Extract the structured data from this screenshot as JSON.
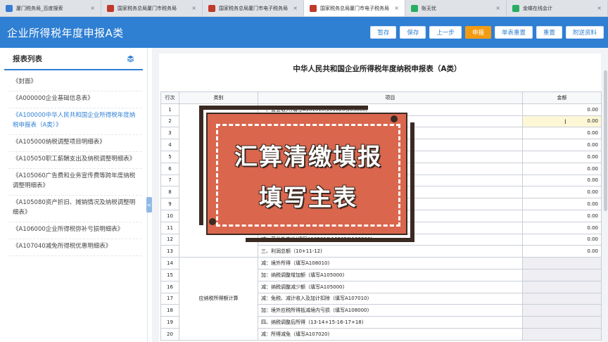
{
  "browser": {
    "tabs": [
      {
        "label": "厦门税务局_百度搜索",
        "color": "#3a7bd5",
        "active": false
      },
      {
        "label": "国家税务总局厦门市税务局",
        "color": "#c0392b",
        "active": false
      },
      {
        "label": "国家税务总局厦门市电子税务局",
        "color": "#c0392b",
        "active": false
      },
      {
        "label": "国家税务总局厦门市电子税务局",
        "color": "#c0392b",
        "active": true
      },
      {
        "label": "账无忧",
        "color": "#27ae60",
        "active": false
      },
      {
        "label": "金蝶在线会计",
        "color": "#27ae60",
        "active": false
      }
    ]
  },
  "header": {
    "title": "企业所得税年度申报A类",
    "buttons": [
      "暂存",
      "保存",
      "上一步",
      "申报",
      "单表重置",
      "重置",
      "附送资料"
    ]
  },
  "sidebar": {
    "title": "报表列表",
    "items": [
      "《封面》",
      "《A000000企业基础信息表》",
      "《A100000中华人民共和国企业所得税年度纳税申报表（A类）》",
      "《A105000纳税调整项目明细表》",
      "《A105050职工薪酬支出及纳税调整明细表》",
      "《A105060广告费和业务宣传费等跨年度纳税调整明细表》",
      "《A105080资产折旧、摊销情况及纳税调整明细表》",
      "《A106000企业所得税弥补亏损明细表》",
      "《A107040减免所得税优惠明细表》"
    ],
    "collapse": "<"
  },
  "form": {
    "title": "中华人民共和国企业所得税年度纳税申报表（A类）",
    "headers": [
      "行次",
      "类别",
      "项目",
      "金额"
    ],
    "rows": [
      {
        "no": "1",
        "item": "一、营业收入(填写A101010\\101020\\103000)",
        "amount": "0.00"
      },
      {
        "no": "2",
        "item": "",
        "amount": "0.00"
      },
      {
        "no": "3",
        "item": "",
        "amount": "0.00"
      },
      {
        "no": "4",
        "item": "",
        "amount": "0.00"
      },
      {
        "no": "5",
        "item": "",
        "amount": "0.00"
      },
      {
        "no": "6",
        "item": "",
        "amount": "0.00"
      },
      {
        "no": "7",
        "item": "",
        "amount": "0.00"
      },
      {
        "no": "8",
        "item": "",
        "amount": "0.00"
      },
      {
        "no": "9",
        "item": "",
        "amount": "0.00"
      },
      {
        "no": "10",
        "item": "",
        "amount": "0.00"
      },
      {
        "no": "11",
        "item": "",
        "amount": "0.00"
      },
      {
        "no": "12",
        "item": "减：营业外支出(填写A102010\\102020\\103000)",
        "amount": "0.00"
      },
      {
        "no": "13",
        "item": "三、利润总额（10+11-12)",
        "amount": "0.00"
      },
      {
        "no": "14",
        "item": "减：境外所得（填写A108010)",
        "amount": ""
      },
      {
        "no": "15",
        "item": "加：纳税调整增加额（填写A105000)",
        "amount": ""
      },
      {
        "no": "16",
        "item": "减：纳税调整减少额（填写A105000)",
        "amount": ""
      },
      {
        "no": "17",
        "item": "减：免税、减计收入及加计扣除（填写A107010)",
        "amount": ""
      },
      {
        "no": "18",
        "item": "加：境外应税所得抵减境内亏损（填写A108000)",
        "amount": ""
      },
      {
        "no": "19",
        "item": "四、纳税调整后所得（13-14+15-16-17+18)",
        "amount": ""
      },
      {
        "no": "20",
        "item": "减：所得减免（填写A107020)",
        "amount": ""
      }
    ],
    "category_label": "应纳税所得额计算"
  },
  "overlay": {
    "line1": "汇算清缴填报",
    "line2": "填写主表"
  },
  "colors": {
    "header_bg": "#2f7fd3",
    "submit_button": "#f39c12",
    "overlay_card": "#d9664d"
  }
}
